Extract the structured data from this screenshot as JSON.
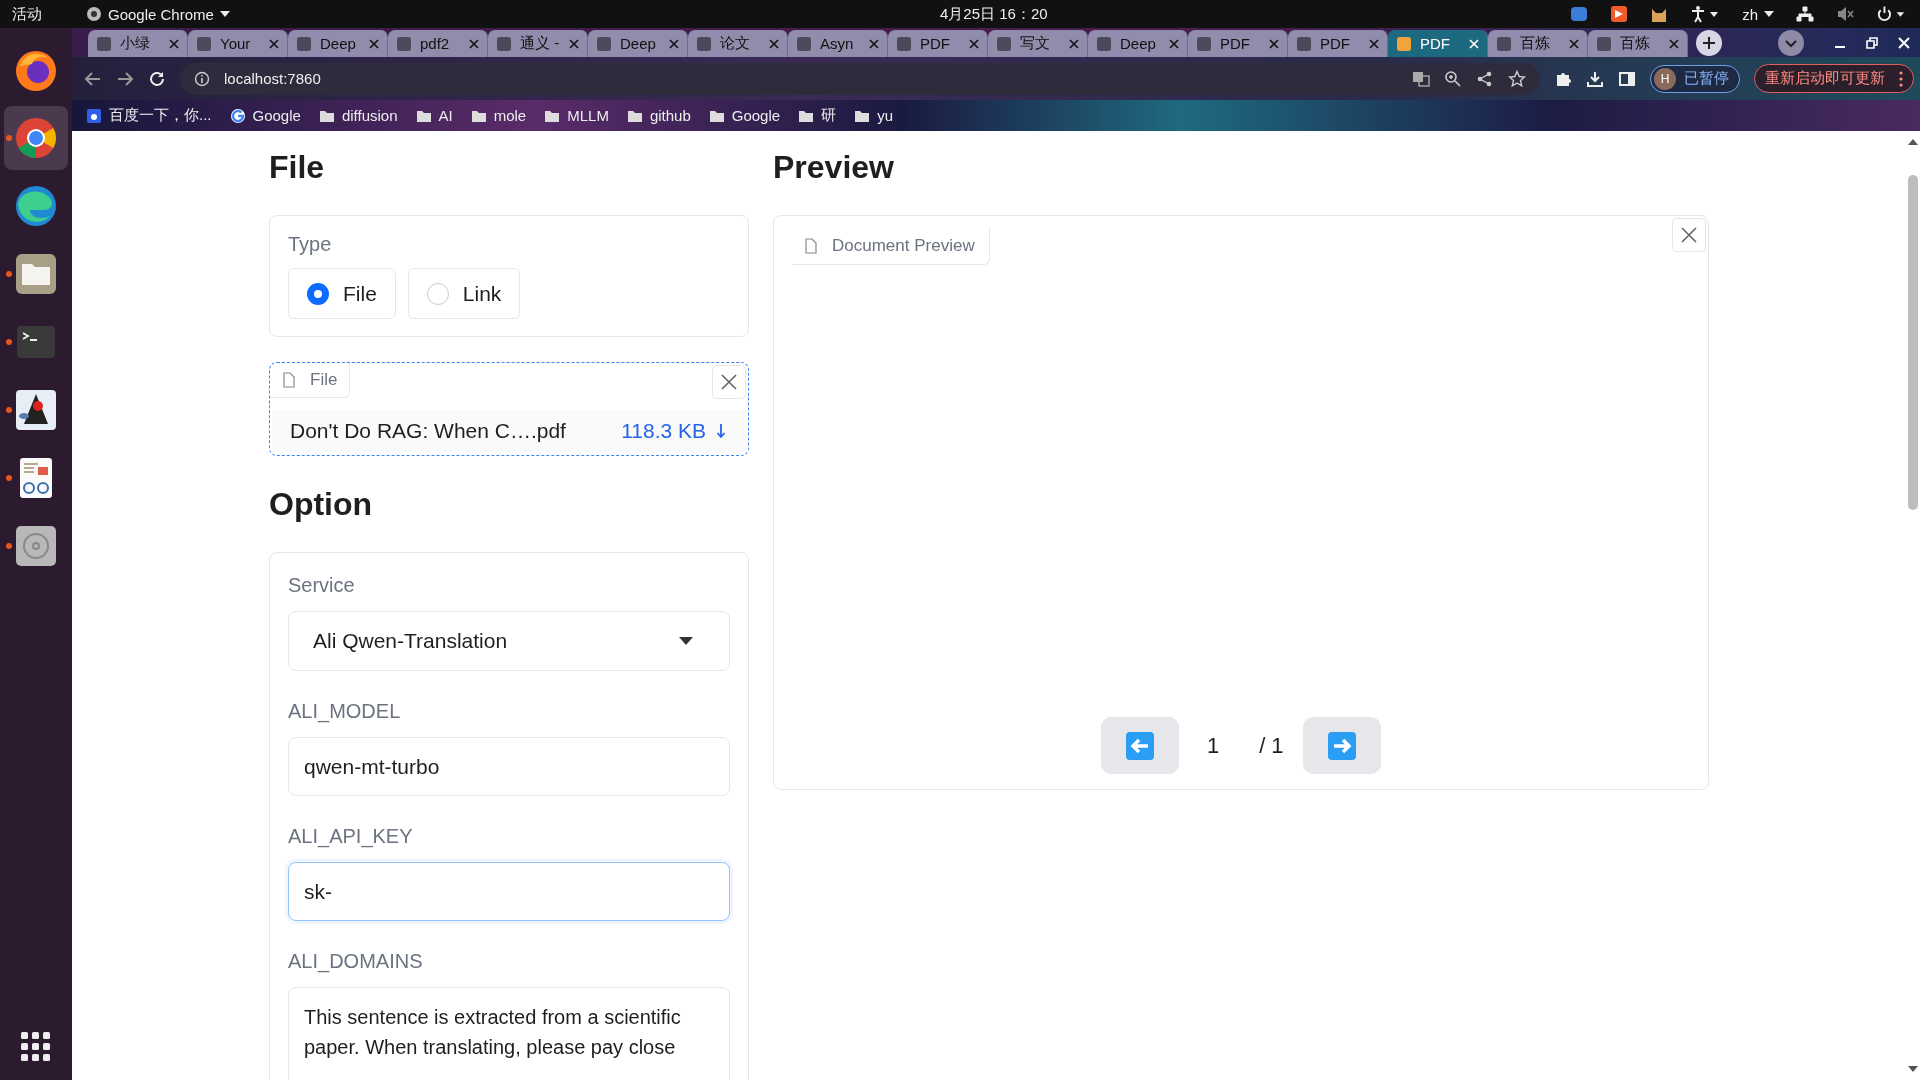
{
  "desktop": {
    "activities": "活动",
    "app_menu": "Google Chrome",
    "clock": "4月25日  16：20",
    "input_method": "zh"
  },
  "dock": [
    {
      "kind": "fox",
      "running": false,
      "selected": false
    },
    {
      "kind": "chrome",
      "running": true,
      "selected": true
    },
    {
      "kind": "edge",
      "running": false,
      "selected": false
    },
    {
      "kind": "files",
      "running": true,
      "selected": false
    },
    {
      "kind": "terminal",
      "running": true,
      "selected": false
    },
    {
      "kind": "mascot",
      "running": true,
      "selected": false
    },
    {
      "kind": "reader",
      "running": true,
      "selected": false
    },
    {
      "kind": "disc",
      "running": true,
      "selected": false
    }
  ],
  "browser": {
    "tabs": [
      {
        "title": "小绿",
        "selected": false
      },
      {
        "title": "Your",
        "selected": false
      },
      {
        "title": "Deep",
        "selected": false
      },
      {
        "title": "pdf2",
        "selected": false
      },
      {
        "title": "通义 -",
        "selected": false
      },
      {
        "title": "Deep",
        "selected": false
      },
      {
        "title": "论文",
        "selected": false
      },
      {
        "title": "Asyn",
        "selected": false
      },
      {
        "title": "PDF",
        "selected": false
      },
      {
        "title": "写文",
        "selected": false
      },
      {
        "title": "Deep",
        "selected": false
      },
      {
        "title": "PDF",
        "selected": false
      },
      {
        "title": "PDF",
        "selected": false
      },
      {
        "title": "PDF",
        "selected": true
      },
      {
        "title": "百炼",
        "selected": false
      },
      {
        "title": "百炼",
        "selected": false
      }
    ],
    "address": "localhost:7860",
    "bookmarks": [
      {
        "kind": "site",
        "label": "百度一下，你..."
      },
      {
        "kind": "site",
        "label": "Google"
      },
      {
        "kind": "folder",
        "label": "diffusion"
      },
      {
        "kind": "folder",
        "label": "AI"
      },
      {
        "kind": "folder",
        "label": "mole"
      },
      {
        "kind": "folder",
        "label": "MLLM"
      },
      {
        "kind": "folder",
        "label": "github"
      },
      {
        "kind": "folder",
        "label": "Google"
      },
      {
        "kind": "folder",
        "label": "研"
      },
      {
        "kind": "folder",
        "label": "yu"
      }
    ],
    "profile": {
      "initial": "H",
      "status": "已暂停"
    },
    "update_button": "重新启动即可更新"
  },
  "file_section": {
    "heading": "File",
    "type_label": "Type",
    "options": [
      {
        "label": "File",
        "selected": true
      },
      {
        "label": "Link",
        "selected": false
      }
    ],
    "upload": {
      "tab_label": "File",
      "file_name": "Don't Do RAG: When C….pdf",
      "file_size": "118.3 KB"
    }
  },
  "option_section": {
    "heading": "Option",
    "service": {
      "label": "Service",
      "value": "Ali Qwen-Translation"
    },
    "fields": [
      {
        "label": "ALI_MODEL",
        "value": "qwen-mt-turbo",
        "focused": false
      },
      {
        "label": "ALI_API_KEY",
        "value": "sk-",
        "focused": true
      }
    ],
    "domains": {
      "label": "ALI_DOMAINS",
      "value": "This sentence is extracted from a scientific paper. When translating, please pay close"
    }
  },
  "preview": {
    "heading": "Preview",
    "tab_label": "Document Preview",
    "page": "1",
    "total": "/ 1"
  }
}
